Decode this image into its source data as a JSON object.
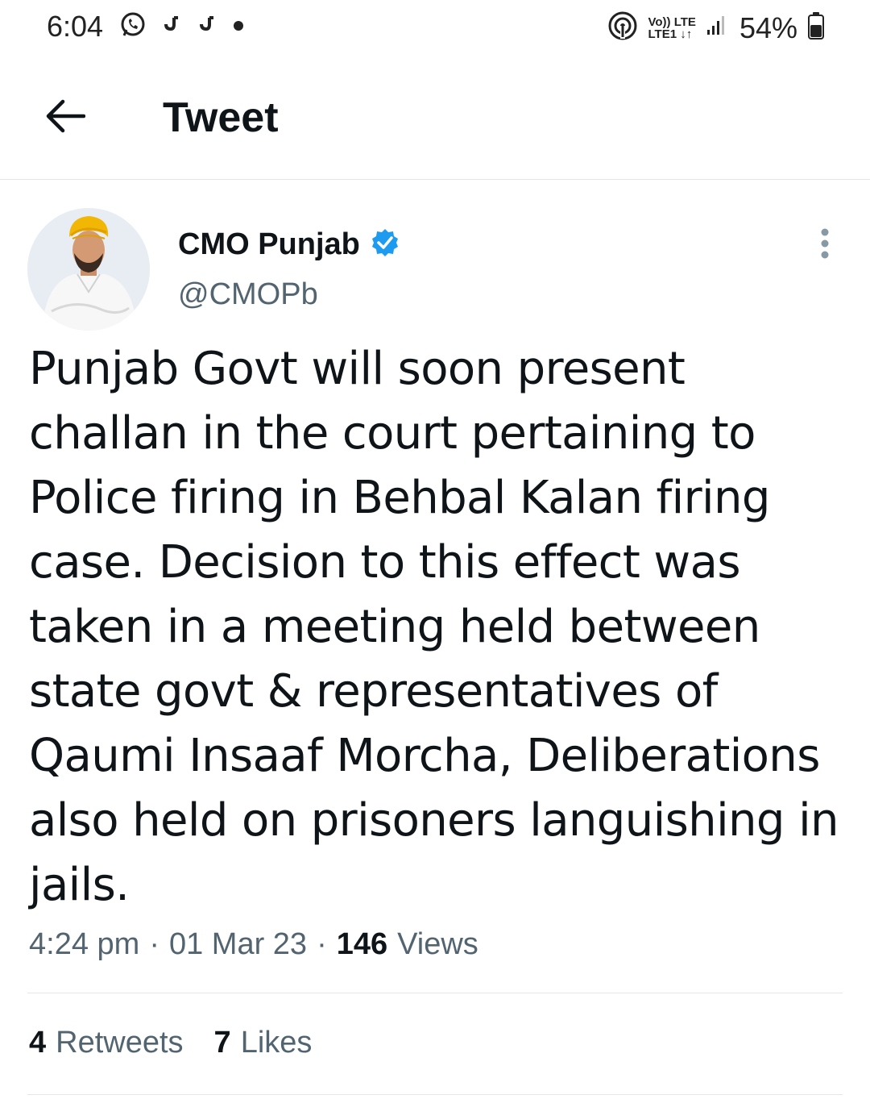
{
  "status_bar": {
    "time": "6:04",
    "net_top": "Vo)) LTE",
    "net_bottom": "LTE1 ↓↑",
    "battery": "54%",
    "icons": [
      "whatsapp-icon",
      "notification-icon",
      "notification-icon",
      "dot-icon",
      "hotspot-icon",
      "signal-icon",
      "battery-icon"
    ]
  },
  "header": {
    "title": "Tweet",
    "back_icon": "arrow-left-icon"
  },
  "author": {
    "name": "CMO Punjab",
    "handle": "@CMOPb",
    "verified": true,
    "verified_color": "#1d9bf0"
  },
  "tweet": {
    "text": "Punjab Govt will soon present\nchallan in the court pertaining to\nPolice firing in Behbal Kalan firing\ncase. Decision to this effect was\ntaken in a meeting held between\nstate govt & representatives of\nQaumi Insaaf Morcha, Deliberations\nalso held on prisoners languishing in\njails.",
    "time": "4:24 pm",
    "date": "01 Mar 23",
    "views_count": "146",
    "views_label": "Views"
  },
  "stats": {
    "retweets_count": "4",
    "retweets_label": "Retweets",
    "likes_count": "7",
    "likes_label": "Likes"
  },
  "colors": {
    "text_primary": "#0f1419",
    "text_secondary": "#536471",
    "divider": "#e6e6e6",
    "accent": "#1d9bf0"
  }
}
